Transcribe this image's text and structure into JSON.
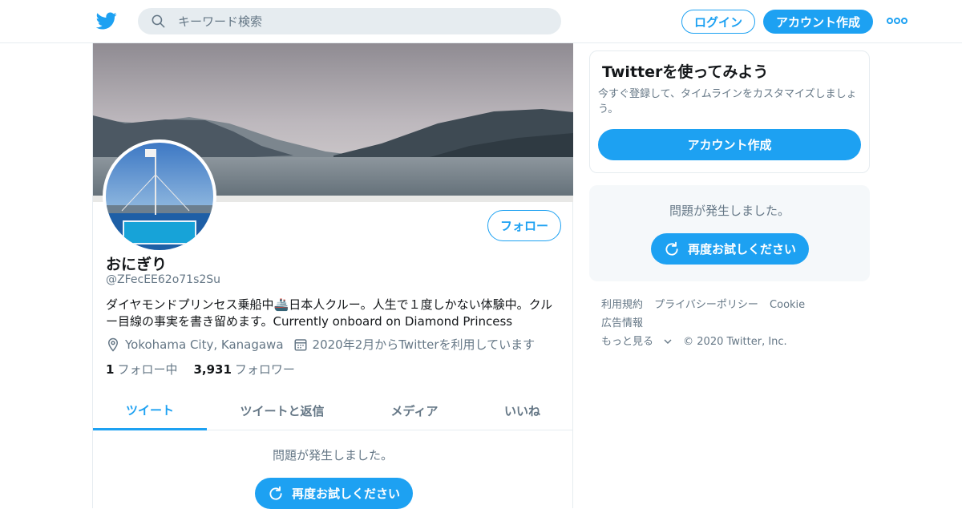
{
  "header": {
    "search_placeholder": "キーワード検索",
    "login_label": "ログイン",
    "signup_label": "アカウント作成"
  },
  "profile": {
    "name": "おにぎり",
    "handle": "@ZFecEE62o71s2Su",
    "bio": "ダイヤモンドプリンセス乗船中🚢日本人クルー。人生で１度しかない体験中。クルー目線の事実を書き留めます。Currently onboard on Diamond Princess",
    "location": "Yokohama City, Kanagawa",
    "joined": "2020年2月からTwitterを利用しています",
    "following_count": "1",
    "following_label": "フォロー中",
    "followers_count": "3,931",
    "followers_label": "フォロワー",
    "follow_button": "フォロー"
  },
  "tabs": [
    {
      "label": "ツイート",
      "active": true
    },
    {
      "label": "ツイートと返信",
      "active": false
    },
    {
      "label": "メディア",
      "active": false
    },
    {
      "label": "いいね",
      "active": false
    }
  ],
  "timeline": {
    "error_text": "問題が発生しました。",
    "retry_label": "再度お試しください"
  },
  "sidebar": {
    "signup_card": {
      "title": "Twitterを使ってみよう",
      "description": "今すぐ登録して、タイムラインをカスタマイズしましょう。",
      "button": "アカウント作成"
    },
    "error_card": {
      "error_text": "問題が発生しました。",
      "retry_label": "再度お試しください"
    },
    "footer": {
      "terms": "利用規約",
      "privacy": "プライバシーポリシー",
      "cookie": "Cookie",
      "ads": "広告情報",
      "more": "もっと見る",
      "copyright": "© 2020 Twitter, Inc."
    }
  },
  "colors": {
    "accent": "#1da1f2",
    "text_primary": "#14171a",
    "text_secondary": "#657786",
    "border": "#e6ecf0",
    "panel_bg": "#f5f8fa"
  }
}
